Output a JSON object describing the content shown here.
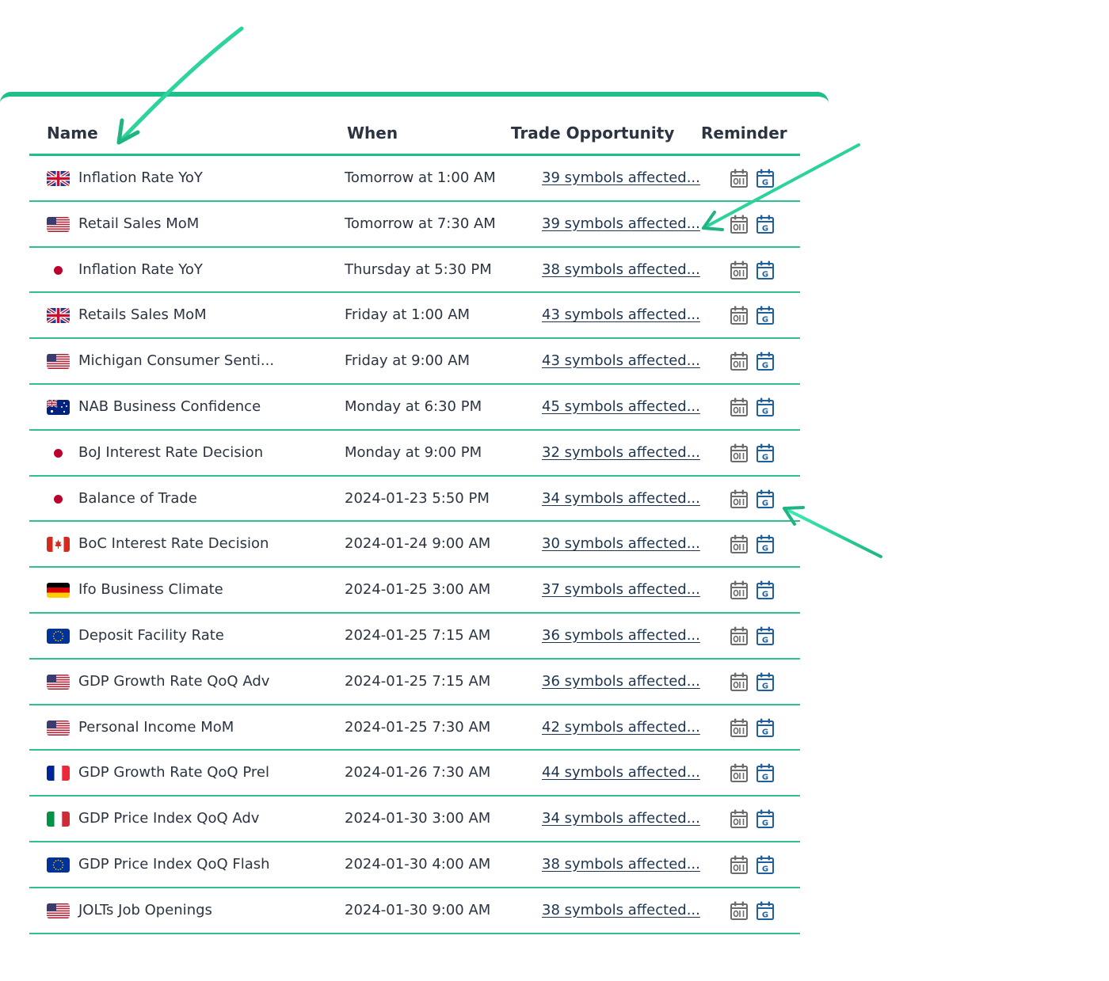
{
  "table": {
    "headers": {
      "name": "Name",
      "when": "When",
      "trade": "Trade Opportunity",
      "reminder": "Reminder"
    },
    "rows": [
      {
        "flag": "uk-flag-icon",
        "name": "Inflation Rate YoY",
        "when": "Tomorrow at 1:00 AM",
        "trade": "39 symbols affected..."
      },
      {
        "flag": "us-flag-icon",
        "name": "Retail Sales MoM",
        "when": "Tomorrow at 7:30 AM",
        "trade": "39 symbols affected..."
      },
      {
        "flag": "jp-flag-icon",
        "name": "Inflation Rate YoY",
        "when": "Thursday at 5:30 PM",
        "trade": "38 symbols affected..."
      },
      {
        "flag": "uk-flag-icon",
        "name": "Retails Sales MoM",
        "when": "Friday at 1:00 AM",
        "trade": "43 symbols affected..."
      },
      {
        "flag": "us-flag-icon",
        "name": "Michigan Consumer Senti...",
        "when": "Friday at 9:00 AM",
        "trade": "43 symbols affected..."
      },
      {
        "flag": "au-flag-icon",
        "name": "NAB Business Confidence",
        "when": "Monday at 6:30 PM",
        "trade": "45 symbols affected..."
      },
      {
        "flag": "jp-flag-icon",
        "name": "BoJ Interest Rate Decision",
        "when": "Monday at 9:00 PM",
        "trade": "32 symbols affected..."
      },
      {
        "flag": "jp-flag-icon",
        "name": "Balance of Trade",
        "when": "2024-01-23 5:50 PM",
        "trade": "34 symbols affected..."
      },
      {
        "flag": "ca-flag-icon",
        "name": "BoC Interest Rate Decision",
        "when": "2024-01-24 9:00 AM",
        "trade": "30 symbols affected..."
      },
      {
        "flag": "de-flag-icon",
        "name": "Ifo Business Climate",
        "when": "2024-01-25 3:00 AM",
        "trade": "37 symbols affected..."
      },
      {
        "flag": "eu-flag-icon",
        "name": "Deposit Facility Rate",
        "when": "2024-01-25 7:15 AM",
        "trade": "36 symbols affected..."
      },
      {
        "flag": "us-flag-icon",
        "name": "GDP Growth Rate QoQ Adv",
        "when": "2024-01-25 7:15 AM",
        "trade": "36 symbols affected..."
      },
      {
        "flag": "us-flag-icon",
        "name": "Personal Income MoM",
        "when": "2024-01-25 7:30 AM",
        "trade": "42 symbols affected..."
      },
      {
        "flag": "fr-flag-icon",
        "name": "GDP Growth Rate QoQ Prel",
        "when": "2024-01-26 7:30 AM",
        "trade": "44 symbols affected..."
      },
      {
        "flag": "it-flag-icon",
        "name": "GDP Price Index QoQ Adv",
        "when": "2024-01-30 3:00 AM",
        "trade": "34 symbols affected..."
      },
      {
        "flag": "eu-flag-icon",
        "name": "GDP Price Index QoQ Flash",
        "when": "2024-01-30 4:00 AM",
        "trade": "38 symbols affected..."
      },
      {
        "flag": "us-flag-icon",
        "name": "JOLTs Job Openings",
        "when": "2024-01-30 9:00 AM",
        "trade": "38 symbols affected..."
      }
    ],
    "reminder_icons": [
      "outlook-calendar-icon",
      "google-calendar-icon"
    ]
  },
  "colors": {
    "accent": "#1fbf8a",
    "link": "#1e3550",
    "gcal_blue": "#1f5f9e",
    "icon_gray": "#6b6b6b"
  }
}
